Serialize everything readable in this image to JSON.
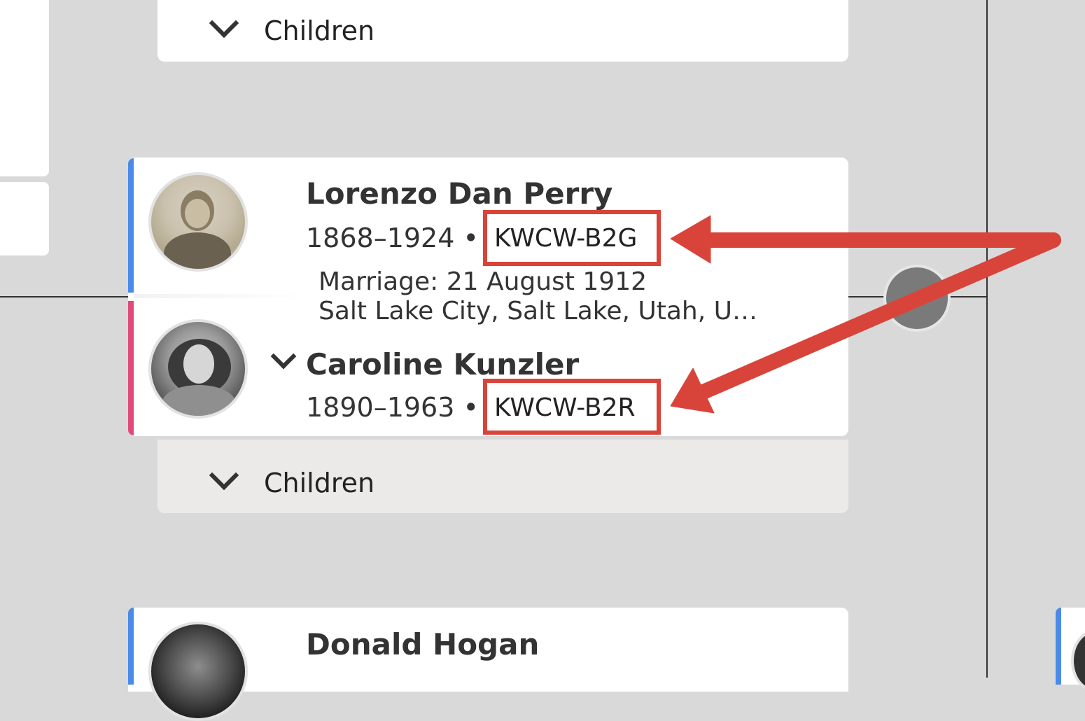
{
  "children_top": {
    "label": "Children"
  },
  "couple": {
    "husband": {
      "name": "Lorenzo Dan Perry",
      "lifespan": "1868–1924 •",
      "pid": "KWCW-B2G"
    },
    "marriage": {
      "date": "Marriage: 21 August 1912",
      "place": "Salt Lake City, Salt Lake, Utah, U…"
    },
    "wife": {
      "name": "Caroline Kunzler",
      "lifespan": "1890–1963 •",
      "pid": "KWCW-B2R"
    }
  },
  "children_bottom": {
    "label": "Children"
  },
  "next_person": {
    "name": "Donald Hogan"
  },
  "colors": {
    "male_stripe": "#4a8ae8",
    "female_stripe": "#e04a7a",
    "annotation": "#d9443a",
    "background": "#d9d9d9"
  },
  "icons": [
    "chevron-down-icon",
    "search-icon",
    "annotation-arrow"
  ]
}
